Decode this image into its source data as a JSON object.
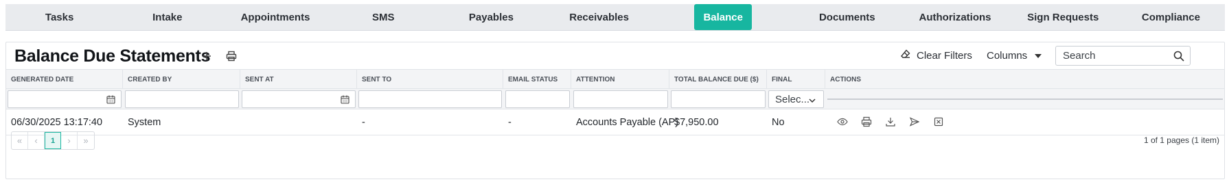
{
  "tabs": [
    {
      "label": "Tasks",
      "active": false
    },
    {
      "label": "Intake",
      "active": false
    },
    {
      "label": "Appointments",
      "active": false
    },
    {
      "label": "SMS",
      "active": false
    },
    {
      "label": "Payables",
      "active": false
    },
    {
      "label": "Receivables",
      "active": false
    },
    {
      "label": "Balance",
      "active": true
    },
    {
      "label": "Documents",
      "active": false
    },
    {
      "label": "Authorizations",
      "active": false
    },
    {
      "label": "Sign Requests",
      "active": false
    },
    {
      "label": "Compliance",
      "active": false
    }
  ],
  "header": {
    "title": "Balance Due Statements",
    "clear_filters_label": "Clear Filters",
    "columns_label": "Columns",
    "search_placeholder": "Search"
  },
  "columns": [
    "GENERATED DATE",
    "CREATED BY",
    "SENT AT",
    "SENT TO",
    "EMAIL STATUS",
    "ATTENTION",
    "TOTAL BALANCE DUE ($)",
    "FINAL",
    "ACTIONS"
  ],
  "filters": {
    "final_select_value": "Selec..."
  },
  "rows": [
    {
      "generated_date": "06/30/2025 13:17:40",
      "created_by": "System",
      "sent_at": "",
      "sent_to": "-",
      "email_status": "-",
      "attention": "Accounts Payable (AP)",
      "total_balance_due": "$7,950.00",
      "final": "No",
      "actions": [
        "view-icon",
        "print-icon",
        "download-icon",
        "send-icon",
        "delete-icon"
      ]
    }
  ],
  "pager": {
    "first": "«",
    "prev": "‹",
    "current_page": "1",
    "next": "›",
    "last": "»",
    "info": "1 of 1 pages (1 item)"
  },
  "colors": {
    "accent": "#17b6a0"
  }
}
